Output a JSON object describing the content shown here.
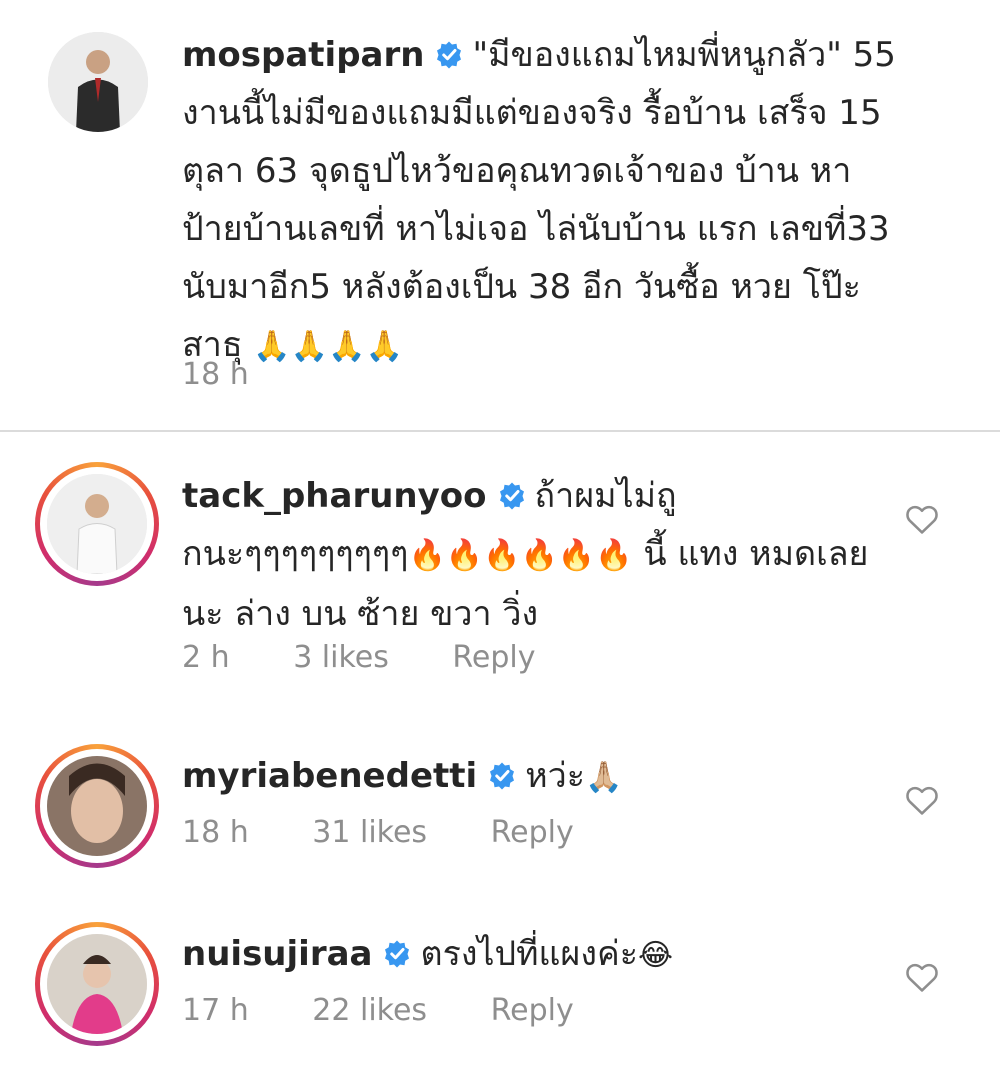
{
  "caption": {
    "username": "mospatiparn",
    "text": "\"มีของแถมไหมพี่หนูกลัว\" 55 งานนี้ไม่มีของแถมมีแต่ของจริง รื้อบ้าน เสร็จ 15 ตุลา 63 จุดธูปไหว้ขอคุณทวดเจ้าของ บ้าน หาป้ายบ้านเลขที่ หาไม่เจอ ไล่นับบ้าน แรก เลขที่33 นับมาอีก5 หลังต้องเป็น 38 อีก วันซื้อ หวย โป๊ะ สาธุ",
    "emojis": "🙏🙏🙏🙏",
    "time": "18 h"
  },
  "comments": [
    {
      "username": "tack_pharunyoo",
      "text": "ถ้าผมไม่ถู กนะๆๆๆๆๆๆๆๆๆ",
      "emojis": "🔥🔥🔥🔥🔥🔥",
      "text_after": "นี้ แทง หมดเลยนะ ล่าง บน ซ้าย ขวา วิ่ง",
      "time": "2 h",
      "likes": "3 likes",
      "reply": "Reply"
    },
    {
      "username": "myriabenedetti",
      "text": "หว่ะ",
      "emojis": "🙏🏼",
      "text_after": "",
      "time": "18 h",
      "likes": "31 likes",
      "reply": "Reply"
    },
    {
      "username": "nuisujiraa",
      "text": "ตรงไปที่แผงค่ะ",
      "emojis": "😂",
      "text_after": "",
      "time": "17 h",
      "likes": "22 likes",
      "reply": "Reply"
    }
  ],
  "icons": {
    "verified": "verified-badge-icon",
    "like": "heart-outline-icon"
  },
  "colors": {
    "verified_blue": "#3897f0",
    "meta_gray": "#8e8e8e",
    "story_ring": "#d02d6b"
  }
}
